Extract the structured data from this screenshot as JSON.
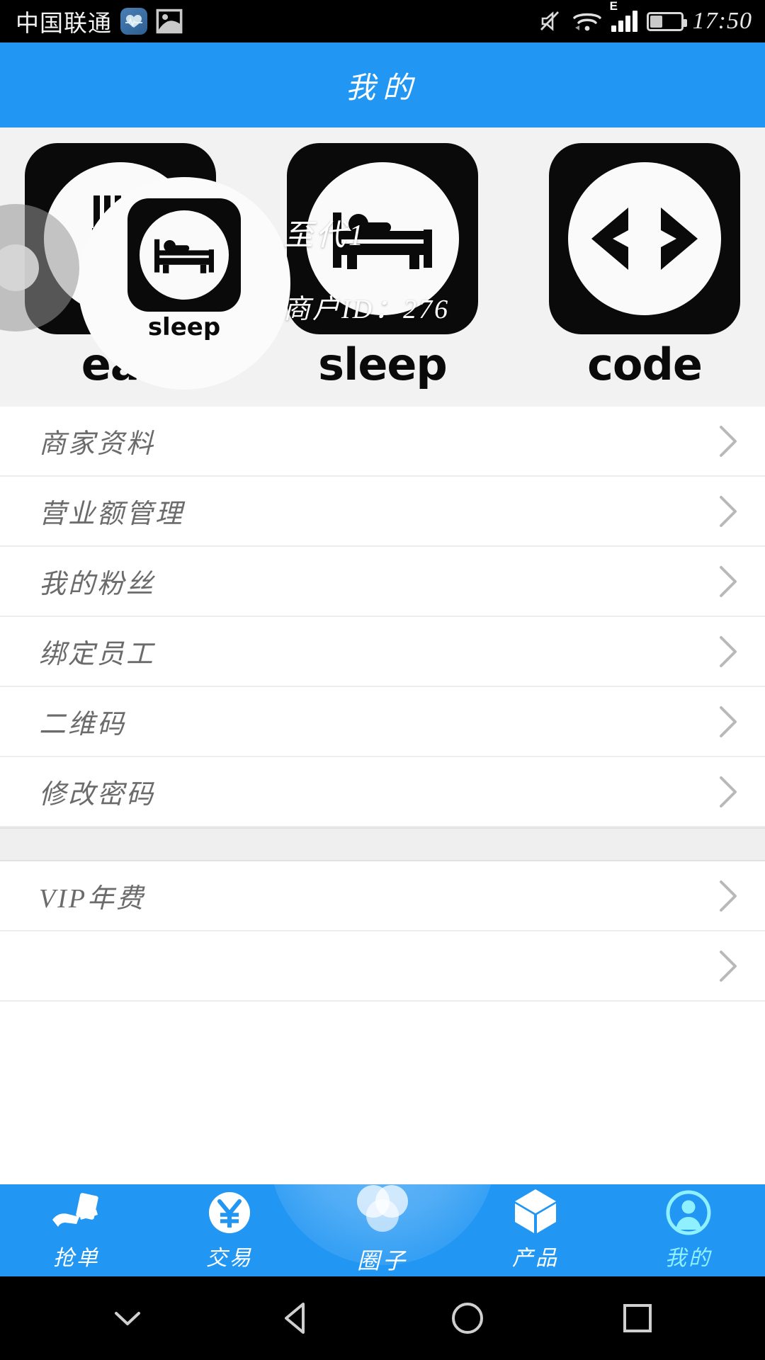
{
  "statusbar": {
    "carrier": "中国联通",
    "time": "17:50",
    "icons": [
      "health-icon",
      "gallery-icon",
      "mute-icon",
      "wifi-icon",
      "signal-icon",
      "battery-icon"
    ],
    "network_type": "E"
  },
  "header": {
    "title": "我的"
  },
  "banner": {
    "tiles": [
      {
        "label": "eat",
        "icon": "fork-knife-icon"
      },
      {
        "label": "sleep",
        "icon": "bed-icon"
      },
      {
        "label": "code",
        "icon": "code-brackets-icon"
      }
    ],
    "badge_label": "sleep",
    "overlay": {
      "name": "至代1",
      "merchant_id": "商户ID：276"
    }
  },
  "menu": {
    "group1": [
      {
        "label": "商家资料"
      },
      {
        "label": "营业额管理"
      },
      {
        "label": "我的粉丝"
      },
      {
        "label": "绑定员工"
      },
      {
        "label": "二维码"
      },
      {
        "label": "修改密码"
      }
    ],
    "group2": [
      {
        "label": "VIP年费"
      }
    ]
  },
  "tabbar": {
    "items": [
      {
        "label": "抢单",
        "icon": "hand-order-icon",
        "active": false
      },
      {
        "label": "交易",
        "icon": "yuan-icon",
        "active": false
      },
      {
        "label": "圈子",
        "icon": "circles-icon",
        "active": false
      },
      {
        "label": "产品",
        "icon": "cube-icon",
        "active": false
      },
      {
        "label": "我的",
        "icon": "person-icon",
        "active": true
      }
    ]
  },
  "navbar": {
    "buttons": [
      "chevron-down-icon",
      "back-icon",
      "home-icon",
      "recents-icon"
    ]
  },
  "colors": {
    "accent": "#2196f3",
    "active_tab": "#8ff0ff",
    "list_text": "#6b6b6b",
    "banner_bg": "#f2f2f2"
  }
}
